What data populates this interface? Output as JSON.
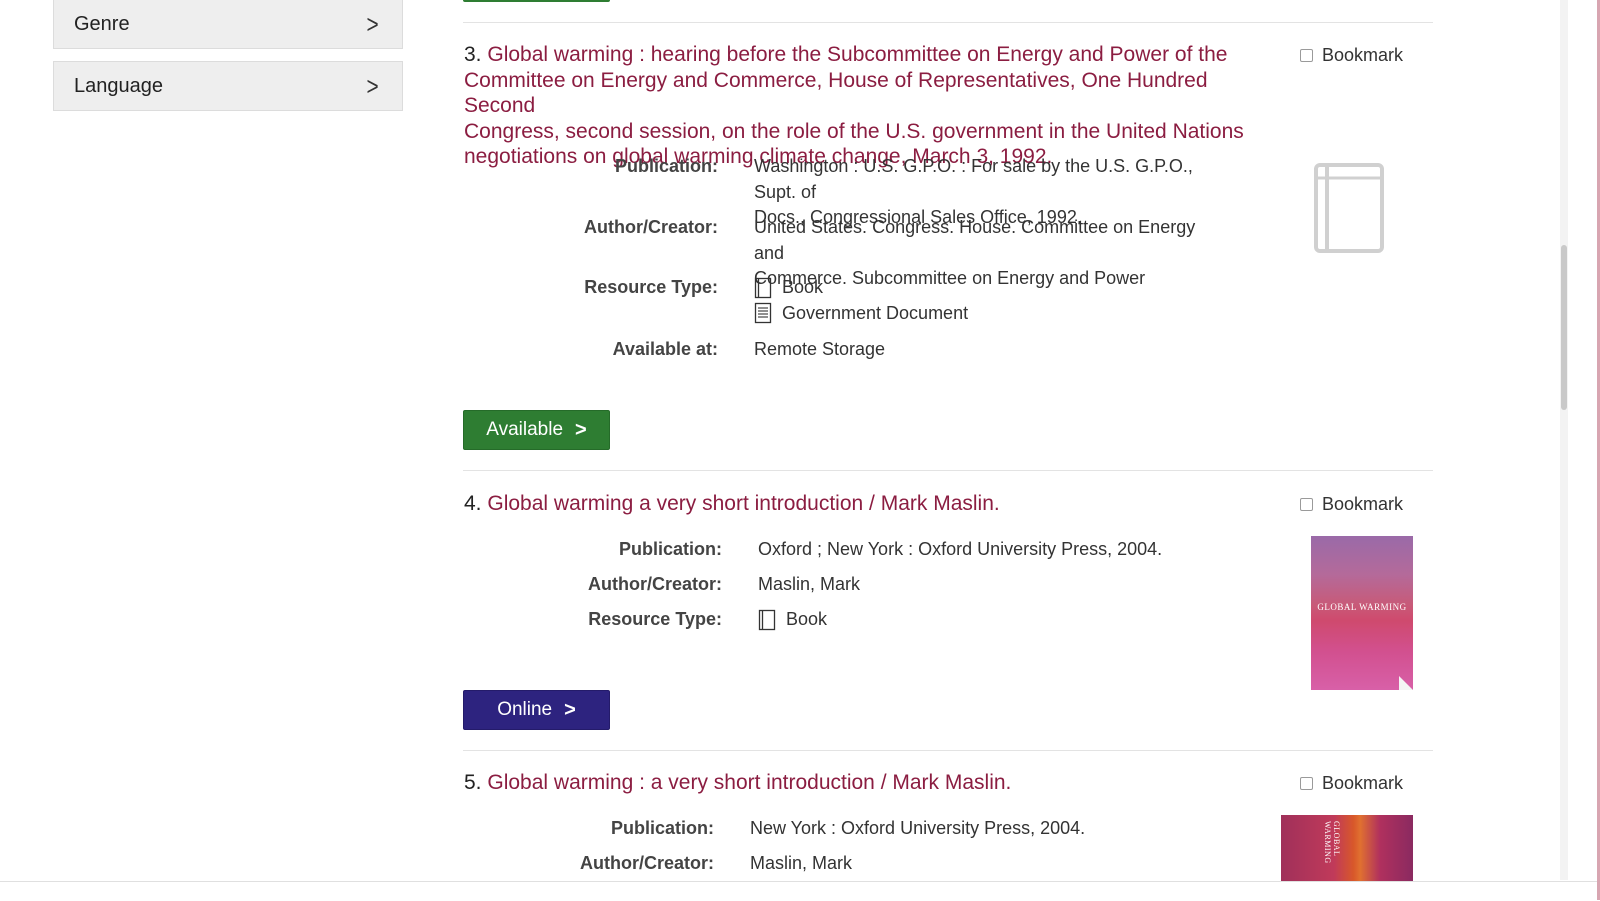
{
  "facets": [
    {
      "label": "Genre"
    },
    {
      "label": "Language"
    }
  ],
  "results": [
    {
      "number": "3.",
      "title_line1": "Global warming : hearing before the Subcommittee on Energy and Power of the",
      "title_line2": "Committee on Energy and Commerce, House of Representatives, One Hundred Second",
      "title_line3": "Congress, second session, on the role of the U.S. government in the United Nations",
      "title_line4": "negotiations on global warming climate change, March 3, 1992.",
      "bookmark_label": "Bookmark",
      "publication_label": "Publication:",
      "publication_line1": "Washington : U.S. G.P.O. : For sale by the U.S. G.P.O., Supt. of",
      "publication_line2": "Docs., Congressional Sales Office, 1992.",
      "author_label": "Author/Creator:",
      "author_line1": "United States. Congress. House. Committee on Energy and",
      "author_line2": "Commerce. Subcommittee on Energy and Power",
      "resource_label": "Resource Type:",
      "resource_types": [
        "Book",
        "Government Document"
      ],
      "available_label": "Available at:",
      "available_value": "Remote Storage",
      "button_label": "Available",
      "thumbnail_icon": "book-placeholder-icon"
    },
    {
      "number": "4.",
      "title": "Global warming a very short introduction / Mark Maslin.",
      "bookmark_label": "Bookmark",
      "publication_label": "Publication:",
      "publication": "Oxford ; New York : Oxford University Press, 2004.",
      "author_label": "Author/Creator:",
      "author": "Maslin, Mark",
      "resource_label": "Resource Type:",
      "resource_types": [
        "Book"
      ],
      "button_label": "Online",
      "cover_text": "GLOBAL WARMING"
    },
    {
      "number": "5.",
      "title": "Global warming : a very short introduction / Mark Maslin.",
      "bookmark_label": "Bookmark",
      "publication_label": "Publication:",
      "publication": "New York : Oxford University Press, 2004.",
      "author_label": "Author/Creator:",
      "author": "Maslin, Mark",
      "cover_text": "GLOBAL WARMING"
    }
  ],
  "colors": {
    "title_link": "#8b1d41",
    "available_button": "#2e7d32",
    "online_button": "#2d237f"
  }
}
